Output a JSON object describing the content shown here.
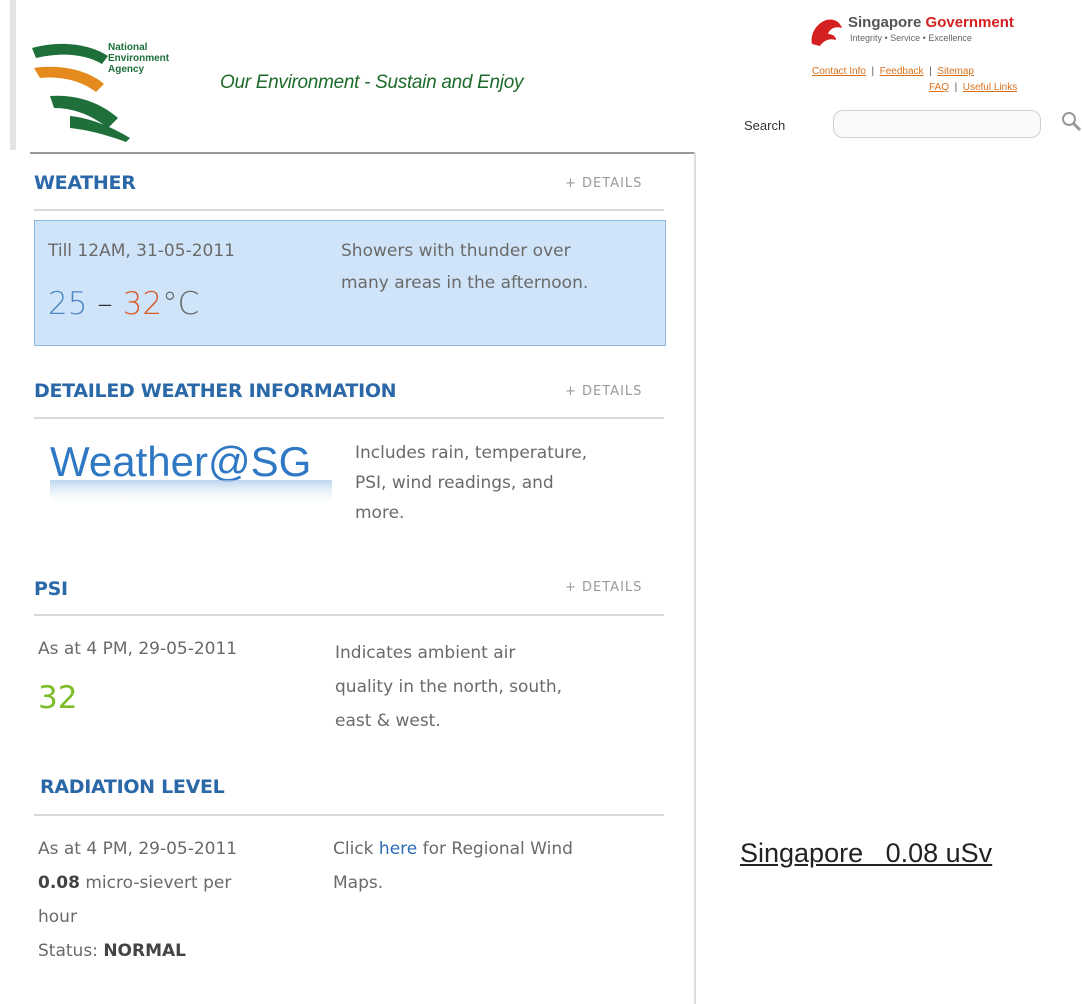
{
  "header": {
    "logo_lines": [
      "National",
      "Environment",
      "Agency"
    ],
    "tagline": "Our Environment - Sustain and Enjoy",
    "gov_name_1": "Singapore",
    "gov_name_2": "Government",
    "gov_motto": "Integrity • Service • Excellence",
    "links_row1": [
      "Contact Info",
      "Feedback",
      "Sitemap"
    ],
    "links_row2": [
      "FAQ",
      "Useful Links"
    ],
    "search_label": "Search",
    "search_value": ""
  },
  "weather": {
    "title": "WEATHER",
    "details": "+ DETAILS",
    "valid_till": "Till 12AM, 31-05-2011",
    "temp_low": "25",
    "temp_dash": " – ",
    "temp_high": "32",
    "temp_unit": "°C",
    "forecast_line1": "Showers with thunder over",
    "forecast_line2": "many areas in the afternoon."
  },
  "detailed": {
    "title": "DETAILED WEATHER INFORMATION",
    "details": "+ DETAILS",
    "logo_text": "Weather@SG",
    "desc_line1": "Includes rain, temperature,",
    "desc_line2": "PSI, wind readings, and",
    "desc_line3": "more."
  },
  "psi": {
    "title": "PSI",
    "details": "+ DETAILS",
    "as_at": "As at 4 PM, 29-05-2011",
    "value": "32",
    "desc_line1": "Indicates ambient air",
    "desc_line2": "quality in the north, south,",
    "desc_line3": "east & west."
  },
  "radiation": {
    "title": "RADIATION LEVEL",
    "as_at": "As at 4 PM, 29-05-2011",
    "value": "0.08",
    "unit_line1": " micro-sievert per",
    "unit_line2": "hour",
    "status_label": "Status: ",
    "status_value": "NORMAL",
    "click_pre": "Click ",
    "click_link": "here",
    "click_post": " for Regional Wind",
    "click_line2": "Maps."
  },
  "bottom_text": "Singapore   0.08 uSv",
  "colors": {
    "section_title": "#2a68a8",
    "weather_box_bg": "#cfe4f8",
    "temp_low": "#4c86c4",
    "temp_high": "#d85a28",
    "psi_value": "#7dbd2a",
    "gov_red": "#d42020"
  }
}
